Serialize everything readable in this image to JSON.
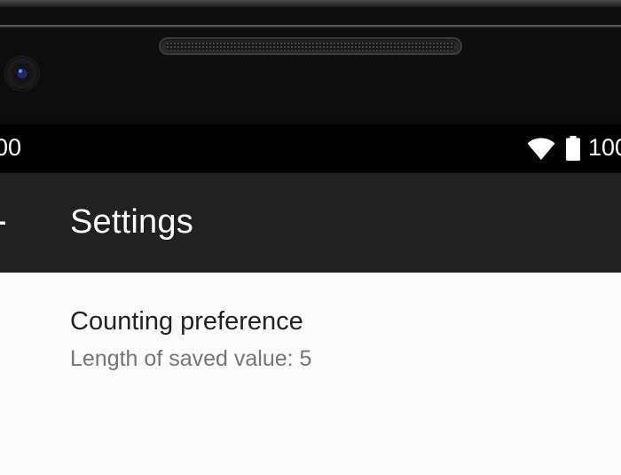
{
  "status_bar": {
    "time": "00",
    "battery_percent": "100",
    "icons": [
      "wifi-icon",
      "battery-icon"
    ]
  },
  "app_bar": {
    "title": "Settings",
    "nav_icon": "back-arrow-icon"
  },
  "preferences": [
    {
      "title": "Counting preference",
      "summary": "Length of saved value: 5"
    }
  ],
  "colors": {
    "status_bar_bg": "#000000",
    "app_bar_bg": "#212121",
    "content_bg": "#fafafa",
    "title_text": "#212121",
    "summary_text": "#757575"
  }
}
